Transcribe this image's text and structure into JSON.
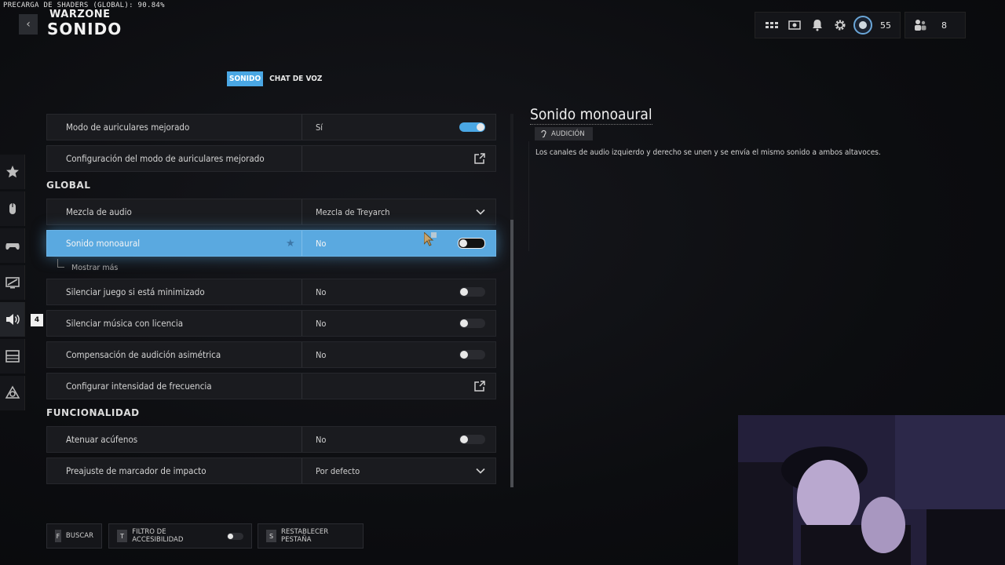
{
  "shader_status": "PRECARGA DE SHADERS (GLOBAL): 90.84%",
  "header": {
    "brand": "WARZONE",
    "title": "SONIDO",
    "back_label": "‹"
  },
  "topbar": {
    "level": "55",
    "friends_count": "8"
  },
  "tabs": [
    {
      "label": "SONIDO",
      "active": true
    },
    {
      "label": "CHAT DE VOZ",
      "active": false
    }
  ],
  "rail_badge": "4",
  "settings": {
    "rows_top": [
      {
        "label": "Modo de auriculares mejorado",
        "value": "Sí",
        "control": "toggle-on"
      },
      {
        "label": "Configuración del modo de auriculares mejorado",
        "value": "",
        "control": "external"
      }
    ],
    "section_global": "GLOBAL",
    "rows_global": [
      {
        "label": "Mezcla de audio",
        "value": "Mezcla de Treyarch",
        "control": "dropdown"
      },
      {
        "label": "Sonido monoaural",
        "value": "No",
        "control": "toggle-selected"
      }
    ],
    "show_more": "Mostrar más",
    "rows_global2": [
      {
        "label": "Silenciar juego si está minimizado",
        "value": "No",
        "control": "toggle-off"
      },
      {
        "label": "Silenciar música con licencia",
        "value": "No",
        "control": "toggle-off"
      },
      {
        "label": "Compensación de audición asimétrica",
        "value": "No",
        "control": "toggle-off"
      },
      {
        "label": "Configurar intensidad de frecuencia",
        "value": "",
        "control": "external"
      }
    ],
    "section_func": "FUNCIONALIDAD",
    "rows_func": [
      {
        "label": "Atenuar acúfenos",
        "value": "No",
        "control": "toggle-off"
      },
      {
        "label": "Preajuste de marcador de impacto",
        "value": "Por defecto",
        "control": "dropdown"
      }
    ]
  },
  "detail": {
    "title": "Sonido monoaural",
    "tag": "AUDICIÓN",
    "description": "Los canales de audio izquierdo y derecho se unen y se envía el mismo sonido a ambos altavoces."
  },
  "footer": {
    "search_key": "F",
    "search_label": "BUSCAR",
    "filter_key": "T",
    "filter_label": "FILTRO DE ACCESIBILIDAD",
    "reset_key": "S",
    "reset_label": "RESTABLECER PESTAÑA"
  },
  "colors": {
    "accent": "#4aa7e4",
    "selected_row": "#5aa9e0",
    "background": "#0c0d10"
  }
}
